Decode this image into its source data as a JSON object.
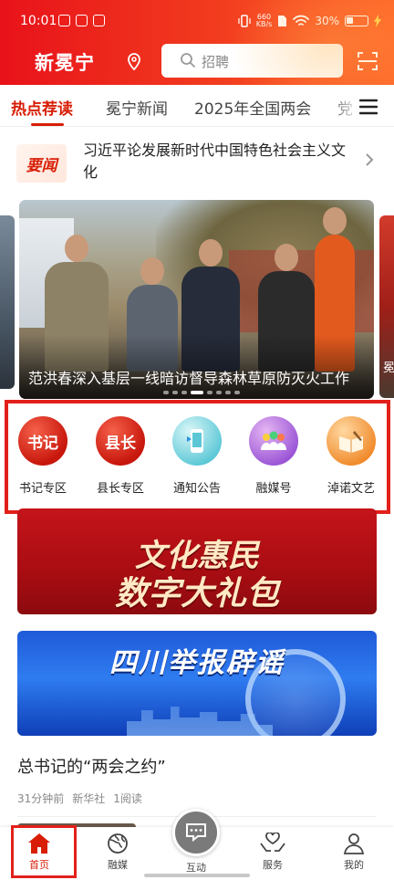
{
  "status_bar": {
    "time": "10:01",
    "net_speed_value": "660",
    "net_speed_unit": "KB/s",
    "battery": "30%"
  },
  "header": {
    "app_title": "新冕宁",
    "search_placeholder": "招聘",
    "brand_color": "#e8121a"
  },
  "tabs": [
    {
      "label": "热点荐读",
      "active": true
    },
    {
      "label": "冕宁新闻",
      "active": false
    },
    {
      "label": "2025年全国两会",
      "active": false
    },
    {
      "label": "党",
      "active": false
    }
  ],
  "headline": {
    "badge": "要闻",
    "text": "习近平论发展新时代中国特色社会主义文化"
  },
  "carousel": {
    "caption": "范洪春深入基层一线暗访督导森林草原防灭火工作",
    "next_peek_text": "冕",
    "total_dots": 8,
    "active_dot": 1
  },
  "shortcuts": [
    {
      "label": "书记专区",
      "icon_text": "书记",
      "icon": "secretary-badge-icon"
    },
    {
      "label": "县长专区",
      "icon_text": "县长",
      "icon": "county-head-badge-icon"
    },
    {
      "label": "通知公告",
      "icon_text": "",
      "icon": "notice-phone-icon"
    },
    {
      "label": "融媒号",
      "icon_text": "",
      "icon": "media-people-icon"
    },
    {
      "label": "淖诺文艺",
      "icon_text": "",
      "icon": "book-quill-icon"
    }
  ],
  "promos": [
    {
      "line1": "文化惠民",
      "line2": "数字大礼包"
    },
    {
      "line1": "四川举报辟谣"
    }
  ],
  "article": {
    "title": "总书记的“两会之约”",
    "time": "31分钟前",
    "source": "新华社",
    "reads": "1阅读"
  },
  "bottom_nav": [
    {
      "label": "首页",
      "icon": "home-icon",
      "active": true
    },
    {
      "label": "融媒",
      "icon": "globe-icon",
      "active": false
    },
    {
      "label": "互动",
      "icon": "chat-icon",
      "active": false
    },
    {
      "label": "服务",
      "icon": "heart-hands-icon",
      "active": false
    },
    {
      "label": "我的",
      "icon": "user-icon",
      "active": false
    }
  ]
}
